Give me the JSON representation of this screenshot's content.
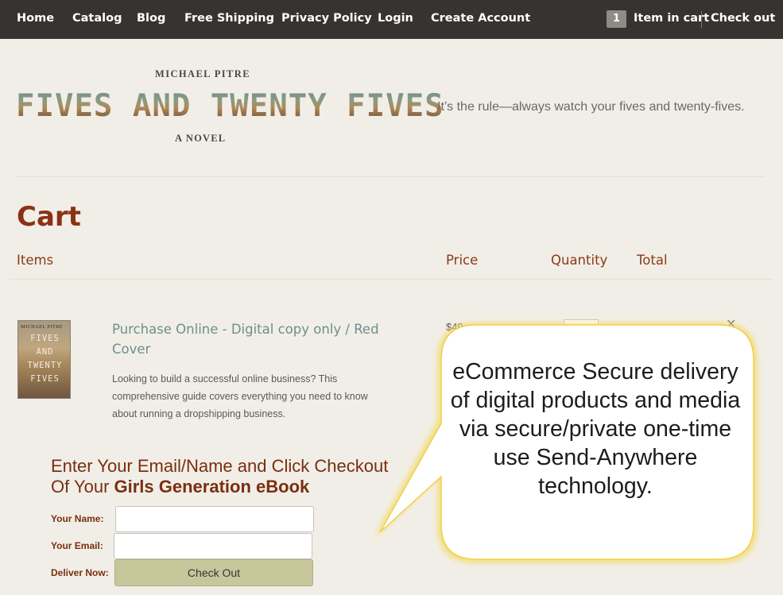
{
  "nav": {
    "home": "Home",
    "catalog": "Catalog",
    "blog": "Blog",
    "free_shipping": "Free Shipping",
    "privacy_policy": "Privacy Policy",
    "login": "Login",
    "create_account": "Create Account",
    "cart_count": "1",
    "cart_label": "Item in cart",
    "checkout": "Check out"
  },
  "header": {
    "author": "MICHAEL PITRE",
    "title": "FIVES AND TWENTY FIVES",
    "subtitle": "A NOVEL",
    "tagline": "It’s the rule—always watch your fives and twenty-fives."
  },
  "cart": {
    "title": "Cart",
    "columns": {
      "items": "Items",
      "price": "Price",
      "quantity": "Quantity",
      "total": "Total"
    },
    "item": {
      "thumb_author": "MICHAEL PITRE",
      "thumb_title_lines": [
        "FIVES",
        "AND",
        "TWENTY",
        "FIVES"
      ],
      "name": "Purchase Online - Digital copy only / Red Cover",
      "description": "Looking to build a successful online business? This comprehensive guide covers everything you need to know about running a dropshipping business.",
      "price": "$49",
      "remove_icon": "close-icon"
    }
  },
  "form": {
    "heading_prefix": "Enter Your Email/Name and Click Checkout",
    "heading_line2_prefix": "Of Your ",
    "heading_bold": "Girls Generation eBook",
    "name_label": "Your Name:",
    "email_label": "Your Email:",
    "deliver_label": "Deliver Now:",
    "name_value": "",
    "email_value": "",
    "checkout_button": "Check Out"
  },
  "callout": {
    "text": "eCommerce Secure delivery of digital products and media via secure/private one-time use Send-Anywhere technology.",
    "fill_color": "#ffffff",
    "glow_color": "#f5dc6a"
  },
  "colors": {
    "nav_bg": "#373331",
    "page_bg": "#f1eee8",
    "heading": "#8a3212",
    "product_link": "#6e8f8c",
    "button": "#c8c79c"
  }
}
